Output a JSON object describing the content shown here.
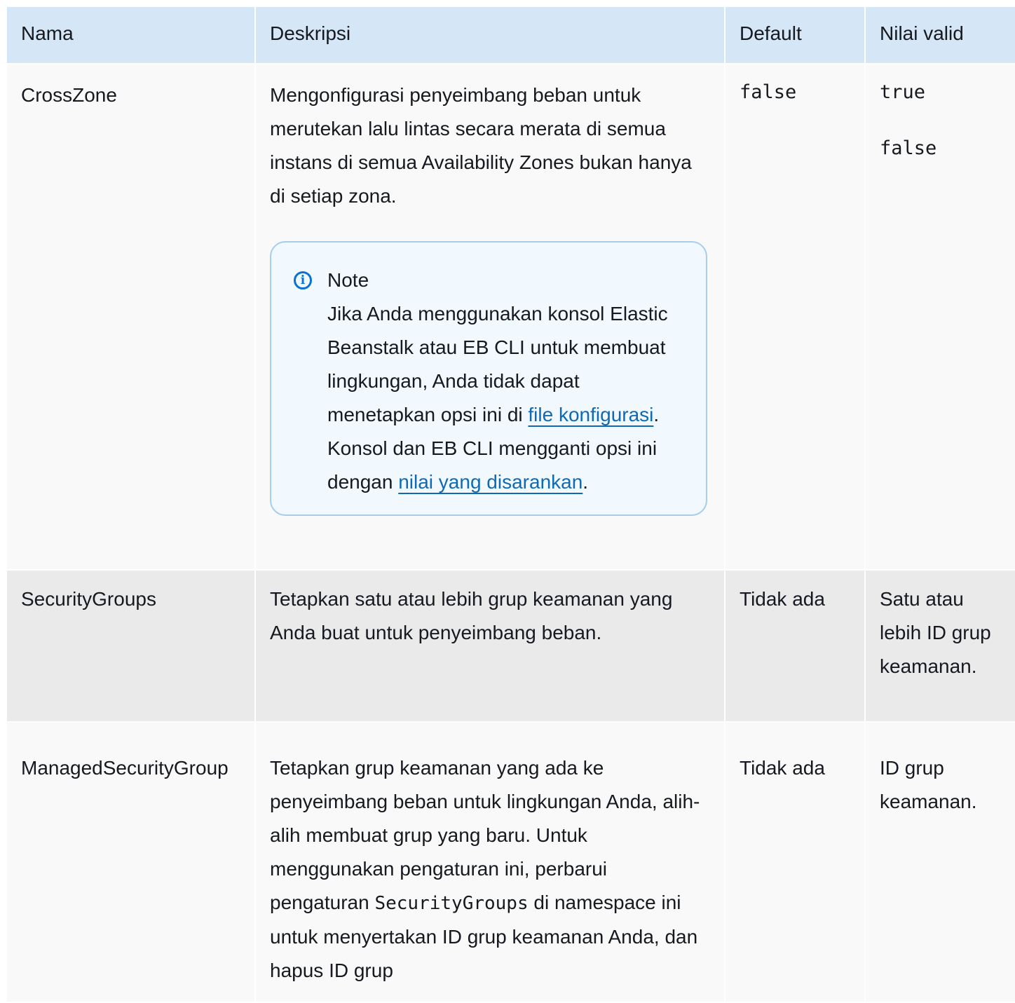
{
  "table": {
    "headers": {
      "name": "Nama",
      "description": "Deskripsi",
      "default": "Default",
      "valid_values": "Nilai valid"
    },
    "rows": [
      {
        "name": "CrossZone",
        "description": "Mengonfigurasi penyeimbang beban untuk merutekan lalu lintas secara merata di semua instans di semua Availability Zones bukan hanya di setiap zona.",
        "note": {
          "title": "Note",
          "icon": "info-icon",
          "text_1": "Jika Anda menggunakan konsol Elastic Beanstalk atau EB CLI untuk membuat lingkungan, Anda tidak dapat menetapkan opsi ini di ",
          "link_1": "file konfigurasi",
          "text_2": ". Konsol dan EB CLI mengganti opsi ini dengan ",
          "link_2": "nilai yang disarankan",
          "text_3": "."
        },
        "default": "false",
        "valid_values": [
          "true",
          "false"
        ]
      },
      {
        "name": "SecurityGroups",
        "description": "Tetapkan satu atau lebih grup keamanan yang Anda buat untuk penyeimbang beban.",
        "default": "Tidak ada",
        "valid_values_text": "Satu atau lebih ID grup keamanan."
      },
      {
        "name": "ManagedSecurityGroup",
        "description_1": "Tetapkan grup keamanan yang ada ke penyeimbang beban untuk lingkungan Anda, alih-alih membuat grup yang baru. Untuk menggunakan pengaturan ini, perbarui pengaturan ",
        "description_code": "SecurityGroups",
        "description_2": " di namespace ini untuk menyertakan ID grup keamanan Anda, dan hapus ID grup",
        "default": "Tidak ada",
        "valid_values_text": "ID grup keamanan."
      }
    ]
  },
  "colors": {
    "header_bg": "#d5e6f6",
    "row_light": "#f9f9f9",
    "row_dark": "#eaeaeb",
    "note_border": "#a4cdee",
    "note_bg": "#f1f8fe",
    "link": "#0f6ab4",
    "info_icon": "#0972d3"
  }
}
